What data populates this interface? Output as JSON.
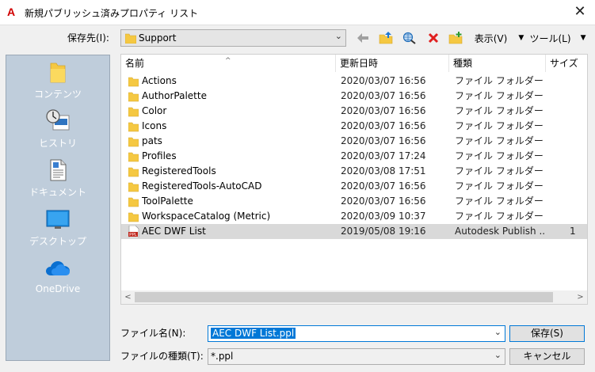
{
  "window": {
    "title": "新規パブリッシュ済みプロパティ リスト",
    "app_icon_letter": "A",
    "close_glyph": "✕"
  },
  "toolbar": {
    "save_in_label": "保存先(I):",
    "location_value": "Support",
    "view_label": "表示(V)",
    "tools_label": "ツール(L)",
    "back_icon": "back-arrow-icon",
    "up_icon": "folder-up-icon",
    "search_web_icon": "search-web-icon",
    "delete_icon": "delete-icon",
    "new_folder_icon": "new-folder-icon"
  },
  "places": [
    {
      "label": "コンテンツ",
      "icon": "folder-icon"
    },
    {
      "label": "ヒストリ",
      "icon": "history-icon"
    },
    {
      "label": "ドキュメント",
      "icon": "documents-icon"
    },
    {
      "label": "デスクトップ",
      "icon": "desktop-icon"
    },
    {
      "label": "OneDrive",
      "icon": "onedrive-icon"
    }
  ],
  "columns": {
    "name": "名前",
    "date": "更新日時",
    "type": "種類",
    "size": "サイズ"
  },
  "files": [
    {
      "name": "Actions",
      "date": "2020/03/07 16:56",
      "type": "ファイル フォルダー",
      "size": "",
      "kind": "folder"
    },
    {
      "name": "AuthorPalette",
      "date": "2020/03/07 16:56",
      "type": "ファイル フォルダー",
      "size": "",
      "kind": "folder"
    },
    {
      "name": "Color",
      "date": "2020/03/07 16:56",
      "type": "ファイル フォルダー",
      "size": "",
      "kind": "folder"
    },
    {
      "name": "Icons",
      "date": "2020/03/07 16:56",
      "type": "ファイル フォルダー",
      "size": "",
      "kind": "folder"
    },
    {
      "name": "pats",
      "date": "2020/03/07 16:56",
      "type": "ファイル フォルダー",
      "size": "",
      "kind": "folder"
    },
    {
      "name": "Profiles",
      "date": "2020/03/07 17:24",
      "type": "ファイル フォルダー",
      "size": "",
      "kind": "folder"
    },
    {
      "name": "RegisteredTools",
      "date": "2020/03/08 17:51",
      "type": "ファイル フォルダー",
      "size": "",
      "kind": "folder"
    },
    {
      "name": "RegisteredTools-AutoCAD",
      "date": "2020/03/07 16:56",
      "type": "ファイル フォルダー",
      "size": "",
      "kind": "folder"
    },
    {
      "name": "ToolPalette",
      "date": "2020/03/07 16:56",
      "type": "ファイル フォルダー",
      "size": "",
      "kind": "folder"
    },
    {
      "name": "WorkspaceCatalog (Metric)",
      "date": "2020/03/09 10:37",
      "type": "ファイル フォルダー",
      "size": "",
      "kind": "folder"
    },
    {
      "name": "AEC DWF List",
      "date": "2019/05/08 19:16",
      "type": "Autodesk Publish ...",
      "size": "1",
      "kind": "ppl"
    }
  ],
  "ppl_icon_text": "PPL",
  "filename": {
    "label": "ファイル名(N):",
    "value": "AEC DWF List.ppl"
  },
  "filetype": {
    "label": "ファイルの種類(T):",
    "value": "*.ppl"
  },
  "buttons": {
    "save": "保存(S)",
    "cancel": "キャンセル"
  },
  "colors": {
    "places_bg": "#bfcddb",
    "folder": "#f5c842",
    "accent": "#0078d7",
    "delete": "#e02020"
  }
}
